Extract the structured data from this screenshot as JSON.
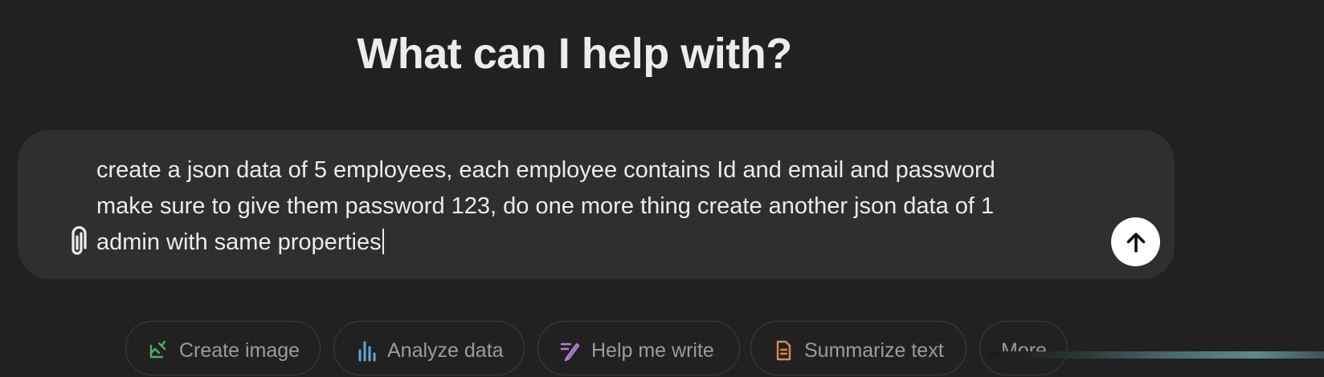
{
  "main": {
    "heading": "What can I help with?"
  },
  "composer": {
    "prompt_line_1": "create a json data of 5 employees, each employee contains Id and email and password",
    "prompt_line_2": "make sure to give them password 123, do one more thing create another json data of 1",
    "prompt_line_3": "admin with same properties",
    "attach_icon": "paperclip-icon",
    "send_icon": "arrow-up-icon"
  },
  "suggestions": [
    {
      "label": "Create image",
      "icon": "image-create-icon",
      "color": "#4caf6a"
    },
    {
      "label": "Analyze data",
      "icon": "bar-chart-icon",
      "color": "#61a8d6"
    },
    {
      "label": "Help me write",
      "icon": "pen-write-icon",
      "color": "#b57fd0"
    },
    {
      "label": "Summarize text",
      "icon": "document-icon",
      "color": "#e0884a"
    },
    {
      "label": "More",
      "icon": ""
    }
  ],
  "colors": {
    "background": "#212121",
    "composer": "#2f2f2f",
    "text": "#ececec",
    "send_button": "#ffffff"
  }
}
